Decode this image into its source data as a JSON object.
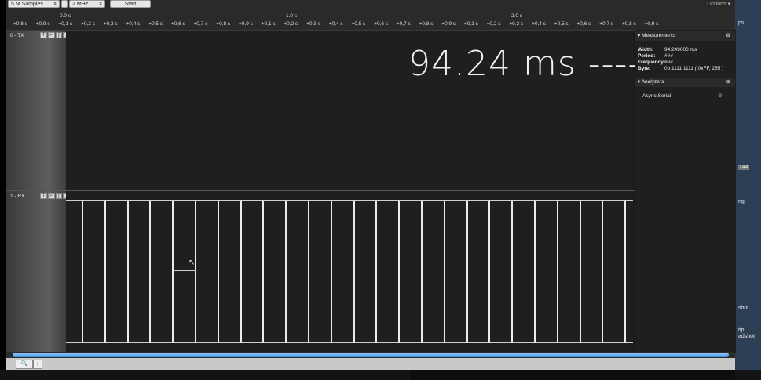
{
  "toolbar": {
    "samples_label": "5 M Samples",
    "rate_label": "2 MHz",
    "start_label": "Start",
    "options_label": "Options ▾"
  },
  "timeline": {
    "major": [
      "0.0 s",
      "1.0 s",
      "2.0 s"
    ],
    "minor": [
      "+0,8 s",
      "+0,9 s",
      "+0,1 s",
      "+0,2 s",
      "+0,3 s",
      "+0,4 s",
      "+0,5 s",
      "+0,6 s",
      "+0,7 s",
      "+0,8 s",
      "+0,9 s",
      "+0,1 s",
      "+0,2 s",
      "+0,3 s",
      "+0,4 s",
      "+0,5 s",
      "+0,6 s",
      "+0,7 s",
      "+0,8 s",
      "+0,9 s",
      "+0,1 s",
      "+0,2 s",
      "+0,3 s",
      "+0,4 s",
      "+0,5 s",
      "+0,6 s",
      "+0,7 s",
      "+0,8 s",
      "+0,9 s"
    ]
  },
  "channels": [
    {
      "name": "0 - TX",
      "buttons": [
        "f",
        "⌐",
        "ʃ",
        "_"
      ]
    },
    {
      "name": "1 - RX",
      "buttons": [
        "f",
        "⌐",
        "ʃ",
        "_"
      ]
    }
  ],
  "annotation": {
    "text": "94.24 ms ----> "
  },
  "measurements": {
    "title": "Measurements",
    "rows": [
      {
        "label": "Width:",
        "value": "94.249000 ms"
      },
      {
        "label": "Period:",
        "value": "###"
      },
      {
        "label": "Frequency:",
        "value": "###"
      },
      {
        "label": "Byte:",
        "value": "0b  1111  1111 ( 0xFF, 255 )"
      }
    ]
  },
  "analyzers": {
    "title": "Analyzers",
    "items": [
      "Async Serial"
    ]
  },
  "desktop": {
    "right_texts": [
      "ps",
      "144",
      "ng",
      "shot",
      "tip",
      "adshot"
    ]
  },
  "rx_pulse_count": 25
}
